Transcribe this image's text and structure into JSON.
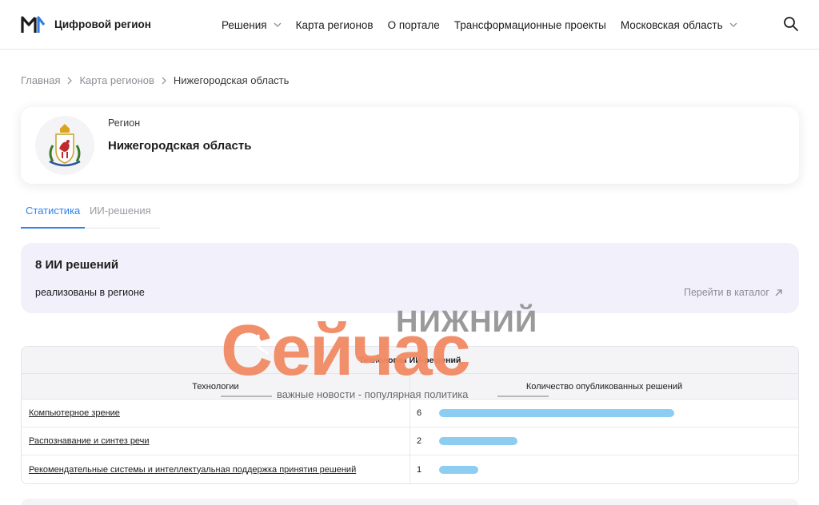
{
  "header": {
    "logo_text": "Цифровой регион",
    "nav": [
      {
        "label": "Решения",
        "has_dropdown": true
      },
      {
        "label": "Карта регионов",
        "has_dropdown": false
      },
      {
        "label": "О портале",
        "has_dropdown": false
      },
      {
        "label": "Трансформационные проекты",
        "has_dropdown": false
      },
      {
        "label": "Московская область",
        "has_dropdown": true
      }
    ],
    "search_icon": "search-icon"
  },
  "breadcrumb": [
    "Главная",
    "Карта регионов",
    "Нижегородская область"
  ],
  "region": {
    "label": "Регион",
    "name": "Нижегородская область"
  },
  "tabs": [
    {
      "label": "Статистика",
      "active": true
    },
    {
      "label": "ИИ-решения",
      "active": false
    }
  ],
  "stats": {
    "count_text": "8 ИИ решений",
    "sub_text": "реализованы в регионе",
    "catalog_link": "Перейти в каталог"
  },
  "table": {
    "caption": "Технологии ИИ-решений",
    "col_technology": "Технологии",
    "col_count": "Количество опубликованных решений",
    "rows": [
      {
        "name": "Компьютерное зрение",
        "count": 6
      },
      {
        "name": "Распознавание и синтез речи",
        "count": 2
      },
      {
        "name": "Рекомендательные системы и интеллектуальная поддержка принятия решений",
        "count": 1
      }
    ]
  },
  "watermark": {
    "top": "НИЖНИЙ",
    "main": "Сейчас",
    "sub": "важные новости - популярная политика"
  },
  "colors": {
    "accent": "#2f80ed",
    "bar": "#8ecdf2",
    "stats_bg": "#f1f0fb",
    "watermark": "#f28a64"
  }
}
